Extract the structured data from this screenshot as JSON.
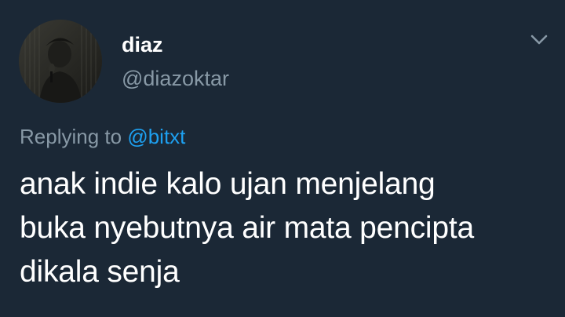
{
  "tweet": {
    "author": {
      "display_name": "diaz",
      "handle": "@diazoktar"
    },
    "reply": {
      "prefix": "Replying to",
      "mention": "@bitxt"
    },
    "text_lines": [
      "anak indie kalo ujan menjelang",
      "buka nyebutnya air mata pencipta",
      "dikala senja"
    ],
    "menu_icon": "chevron-down-icon",
    "colors": {
      "background": "#1b2836",
      "primary_text": "#ffffff",
      "secondary_text": "#8899a6",
      "link": "#1da1f2"
    }
  }
}
